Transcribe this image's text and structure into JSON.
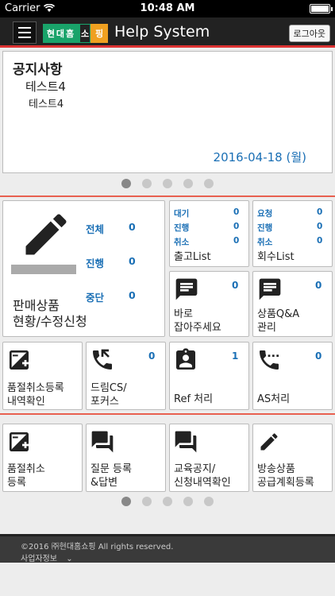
{
  "status_bar": {
    "carrier": "Carrier",
    "time": "10:48 AM"
  },
  "header": {
    "logo_part1": "현대홈",
    "logo_part2": "소",
    "logo_part3": "핑",
    "title": "Help System",
    "logout_label": "로그아웃"
  },
  "notice": {
    "heading": "공지사항",
    "title": "테스트4",
    "body": "테스트4",
    "date": "2016-04-18 (월)"
  },
  "carousel_top": {
    "count": 5,
    "active": 0
  },
  "sales": {
    "stats": [
      {
        "label": "전체",
        "value": "0"
      },
      {
        "label": "진행",
        "value": "0"
      },
      {
        "label": "중단",
        "value": "0"
      }
    ],
    "title_line1": "판매상품",
    "title_line2": "현황/수정신청"
  },
  "shipping": {
    "rows": [
      {
        "label": "대기",
        "value": "0"
      },
      {
        "label": "진행",
        "value": "0"
      },
      {
        "label": "취소",
        "value": "0"
      }
    ],
    "title": "출고List"
  },
  "recall": {
    "rows": [
      {
        "label": "요청",
        "value": "0"
      },
      {
        "label": "진행",
        "value": "0"
      },
      {
        "label": "취소",
        "value": "0"
      }
    ],
    "title": "회수List"
  },
  "catch_now": {
    "line1": "바로",
    "line2": "잡아주세요",
    "count": "0"
  },
  "product_qa": {
    "line1": "상품Q&A",
    "line2": "관리",
    "count": "0"
  },
  "soldout_reg": {
    "line1": "품절취소등록",
    "line2": "내역확인"
  },
  "dream_cs": {
    "line1": "드림CS/",
    "line2": "포커스",
    "count": "0"
  },
  "ref": {
    "line1": "Ref 처리",
    "count": "1"
  },
  "as": {
    "line1": "AS처리",
    "count": "0"
  },
  "bottom_tiles": [
    {
      "line1": "품절취소",
      "line2": "등록"
    },
    {
      "line1": "질문 등록",
      "line2": "&답변"
    },
    {
      "line1": "교육공지/",
      "line2": "신청내역확인"
    },
    {
      "line1": "방송상품",
      "line2": "공급계획등록"
    }
  ],
  "carousel_bottom": {
    "count": 5,
    "active": 0
  },
  "footer": {
    "copyright": "©2016 ㈜현대홈쇼핑 All rights reserved.",
    "business_info": "사업자정보"
  },
  "colors": {
    "accent_blue": "#1a6fb5",
    "divider_red": "#e86050",
    "logo_green": "#19a36a",
    "logo_orange": "#f0a020"
  },
  "icons": {
    "pencil": "pencil-icon",
    "message": "message-icon",
    "sold_out": "sold-out-icon",
    "phone_forward": "phone-forward-icon",
    "clipboard_user": "clipboard-user-icon",
    "phone_dial": "phone-dial-icon",
    "forum": "forum-icon",
    "edit": "edit-icon"
  }
}
